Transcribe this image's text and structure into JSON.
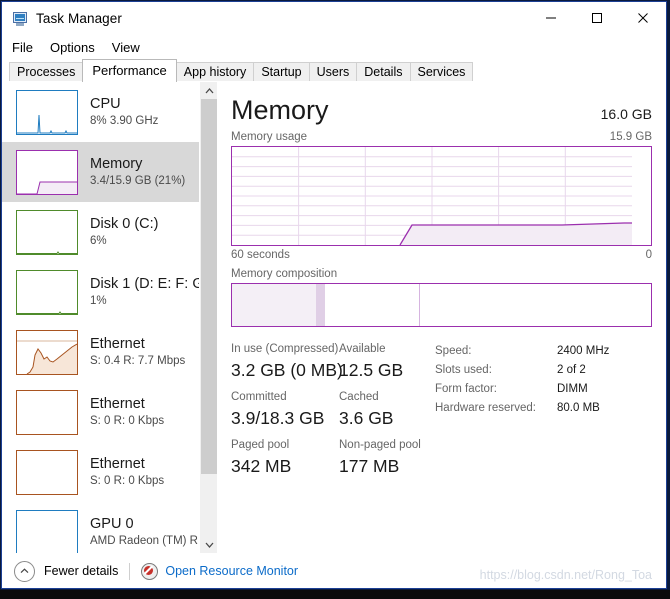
{
  "window": {
    "title": "Task Manager",
    "icon": "task-manager-icon",
    "controls": {
      "minimize": "minimize-icon",
      "maximize": "maximize-icon",
      "close": "close-icon"
    }
  },
  "menu": {
    "items": [
      "File",
      "Options",
      "View"
    ]
  },
  "tabs": {
    "active": "Performance",
    "items": [
      "Processes",
      "Performance",
      "App history",
      "Startup",
      "Users",
      "Details",
      "Services"
    ]
  },
  "sidebar": {
    "items": [
      {
        "title": "CPU",
        "sub": "8%  3.90 GHz",
        "color": "#1f7cc0",
        "selected": false,
        "spark": "cpu"
      },
      {
        "title": "Memory",
        "sub": "3.4/15.9 GB (21%)",
        "color": "#9b2fae",
        "selected": true,
        "spark": "memory"
      },
      {
        "title": "Disk 0 (C:)",
        "sub": "6%",
        "color": "#4f8b2b",
        "selected": false,
        "spark": "flat"
      },
      {
        "title": "Disk 1 (D: E: F: G",
        "sub": "1%",
        "color": "#4f8b2b",
        "selected": false,
        "spark": "flat"
      },
      {
        "title": "Ethernet",
        "sub": "S: 0.4 R: 7.7 Mbps",
        "color": "#a85420",
        "selected": false,
        "spark": "net"
      },
      {
        "title": "Ethernet",
        "sub": "S: 0 R: 0 Kbps",
        "color": "#a85420",
        "selected": false,
        "spark": "blank"
      },
      {
        "title": "Ethernet",
        "sub": "S: 0 R: 0 Kbps",
        "color": "#a85420",
        "selected": false,
        "spark": "blank"
      },
      {
        "title": "GPU 0",
        "sub": "AMD Radeon (TM) R",
        "color": "#1f7cc0",
        "selected": false,
        "spark": "blank"
      }
    ],
    "scrollbar": {
      "up": "chevron-up-icon",
      "down": "chevron-down-icon"
    }
  },
  "main": {
    "title": "Memory",
    "total": "16.0 GB",
    "usage_label": "Memory usage",
    "usage_max": "15.9 GB",
    "axis_left": "60 seconds",
    "axis_right": "0",
    "composition_label": "Memory composition",
    "accent": "#9b2fae",
    "stats": [
      {
        "label": "In use (Compressed)",
        "value": "3.2 GB (0 MB)"
      },
      {
        "label": "Available",
        "value": "12.5 GB"
      },
      {
        "label": "Committed",
        "value": "3.9/18.3 GB"
      },
      {
        "label": "Cached",
        "value": "3.6 GB"
      },
      {
        "label": "Paged pool",
        "value": "342 MB"
      },
      {
        "label": "Non-paged pool",
        "value": "177 MB"
      }
    ],
    "specs": [
      {
        "key": "Speed:",
        "value": "2400 MHz"
      },
      {
        "key": "Slots used:",
        "value": "2 of 2"
      },
      {
        "key": "Form factor:",
        "value": "DIMM"
      },
      {
        "key": "Hardware reserved:",
        "value": "80.0 MB"
      }
    ]
  },
  "chart_data": {
    "type": "area",
    "title": "Memory usage",
    "xlabel": "60 seconds",
    "ylabel": "Memory",
    "ylim": [
      0,
      15.9
    ],
    "xlim": [
      60,
      0
    ],
    "grid": true,
    "legend": "none",
    "line_color": "#9b2fae",
    "fill_color": "#f3ecf5",
    "x": [
      60,
      48,
      36,
      30,
      27,
      26,
      24,
      18,
      12,
      6,
      2,
      0
    ],
    "values": [
      0,
      0,
      0,
      0,
      0,
      1.1,
      3.2,
      3.2,
      3.2,
      3.2,
      3.3,
      3.4
    ],
    "annotations": [
      "16.0 GB total",
      "15.9 GB max",
      "3.4/15.9 GB (21%) in use"
    ]
  },
  "composition": {
    "type": "bar",
    "total_gb": 15.9,
    "segments": [
      {
        "name": "in-use",
        "gb": 3.2,
        "fill": "#f4eff6"
      },
      {
        "name": "modified",
        "gb": 0.35,
        "fill": "#e0cfe6"
      },
      {
        "name": "standby-cached",
        "gb": 3.6,
        "fill": "#ffffff"
      },
      {
        "name": "free",
        "gb": 8.75,
        "fill": "#ffffff"
      }
    ]
  },
  "footer": {
    "fewer_details": "Fewer details",
    "chevron": "chevron-up-circle-icon",
    "resource_monitor": "Open Resource Monitor",
    "resource_monitor_icon": "resource-monitor-icon",
    "link_color": "#0b6bc9"
  },
  "watermark": "https://blog.csdn.net/Rong_Toa"
}
